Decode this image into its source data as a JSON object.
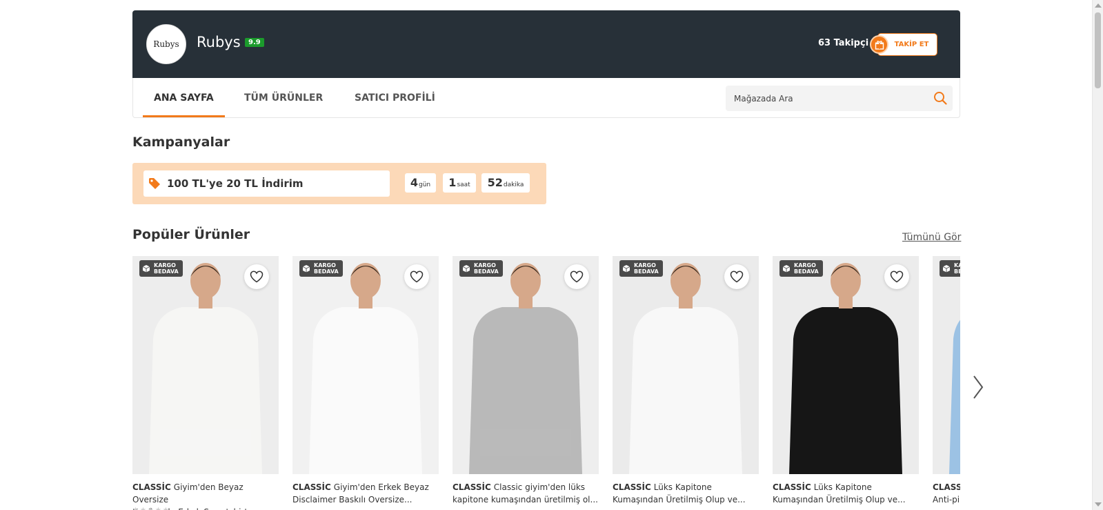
{
  "store": {
    "logo_text": "Rubys",
    "name": "Rubys",
    "rating": "9.9",
    "followers": "63 Takipçi",
    "follow_label": "TAKİP ET"
  },
  "nav": {
    "tabs": [
      {
        "label": "ANA SAYFA",
        "active": true
      },
      {
        "label": "TÜM ÜRÜNLER",
        "active": false
      },
      {
        "label": "SATICI PROFİLİ",
        "active": false
      }
    ],
    "search_placeholder": "Mağazada Ara"
  },
  "campaigns": {
    "title": "Kampanyalar",
    "items": [
      {
        "text": "100 TL'ye 20 TL İndirim",
        "countdown": [
          {
            "value": "4",
            "unit": "gün"
          },
          {
            "value": "1",
            "unit": "saat"
          },
          {
            "value": "52",
            "unit": "dakika"
          }
        ]
      }
    ]
  },
  "popular": {
    "title": "Popüler Ürünler",
    "see_all": "Tümünü Gör",
    "badge_line1": "KARGO",
    "badge_line2": "BEDAVA",
    "products": [
      {
        "brand": "CLASSİC",
        "line1": "Giyim'den Beyaz Oversize",
        "line2": "Kapüşonlu Erkek Sweatshirt...",
        "garment_color": "#f6f6f4",
        "bg": "#ededed"
      },
      {
        "brand": "CLASSİC",
        "line1": "Giyim'den Erkek Beyaz",
        "line2": "Disclaimer Baskılı Oversize...",
        "garment_color": "#fafafa",
        "bg": "#f1f1f1"
      },
      {
        "brand": "CLASSİC",
        "line1": "Classic giyim'den lüks",
        "line2": "kapitone kumaşından üretilmiş ol...",
        "garment_color": "#b9b9b9",
        "bg": "#eeeeee"
      },
      {
        "brand": "CLASSİC",
        "line1": "Lüks Kapitone",
        "line2": "Kumaşından Üretilmiş Olup ve...",
        "garment_color": "#f8f8f8",
        "bg": "#ebebeb"
      },
      {
        "brand": "CLASSİC",
        "line1": "Lüks Kapitone",
        "line2": "Kumaşından Üretilmiş Olup ve...",
        "garment_color": "#161616",
        "bg": "#ececec"
      },
      {
        "brand": "CLASSİ",
        "line1": "",
        "line2": "Anti-pil",
        "garment_color": "#9cc2e4",
        "bg": "#ececec"
      }
    ]
  }
}
